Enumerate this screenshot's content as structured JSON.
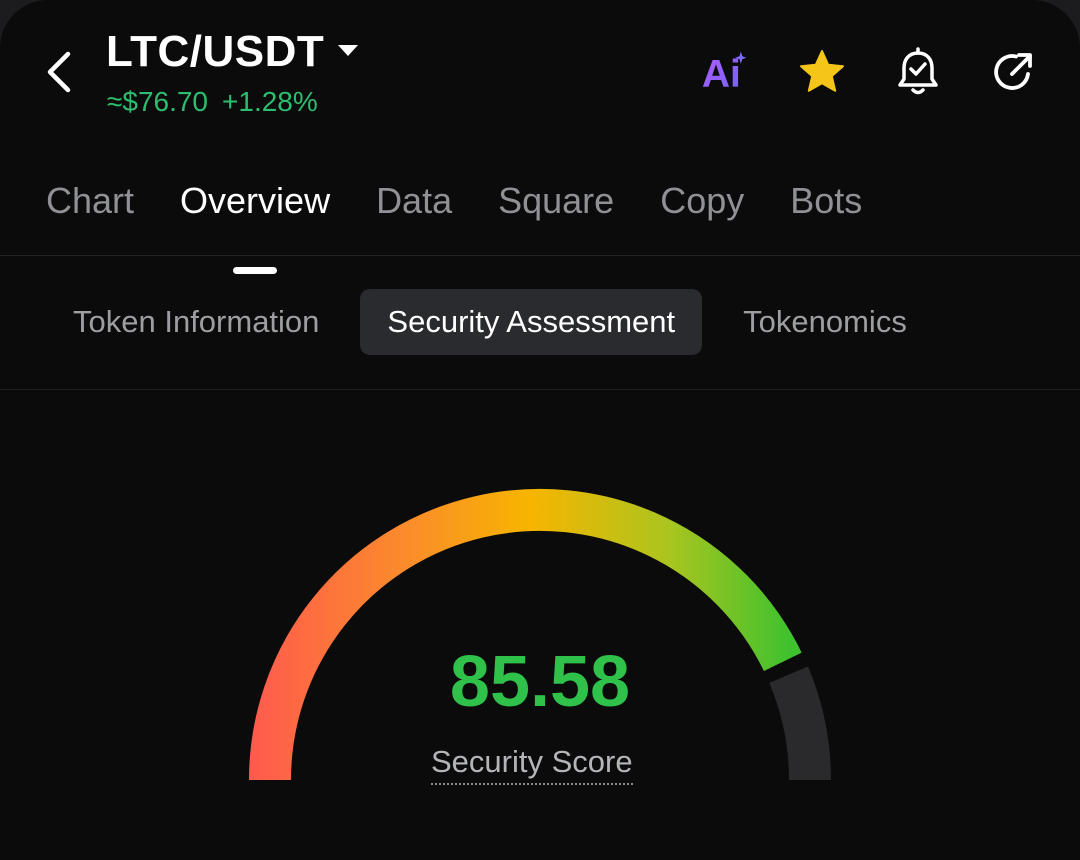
{
  "header": {
    "pair": "LTC/USDT",
    "price": "≈$76.70",
    "change": "+1.28%",
    "icons": [
      "back-icon",
      "ai-icon",
      "star-icon",
      "alert-bell-icon",
      "share-icon"
    ],
    "ai_label": "Ai"
  },
  "main_tabs": {
    "chart": "Chart",
    "overview": "Overview",
    "data": "Data",
    "square": "Square",
    "copy": "Copy",
    "bots": "Bots",
    "active": "Overview"
  },
  "sub_tabs": {
    "token_information": "Token Information",
    "security_assessment": "Security Assessment",
    "tokenomics": "Tokenomics",
    "active": "Security Assessment"
  },
  "security": {
    "score": "85.58",
    "score_label": "Security Score",
    "gauge_fraction": 0.8558
  },
  "colors": {
    "background": "#0b0b0c",
    "positive": "#2ebd6e",
    "score": "#2fc14a",
    "star": "#f5c518",
    "gauge_start": "#ff5a4e",
    "gauge_mid": "#f7b500",
    "gauge_end": "#3fc12e",
    "gauge_track": "#2a2a2d"
  }
}
